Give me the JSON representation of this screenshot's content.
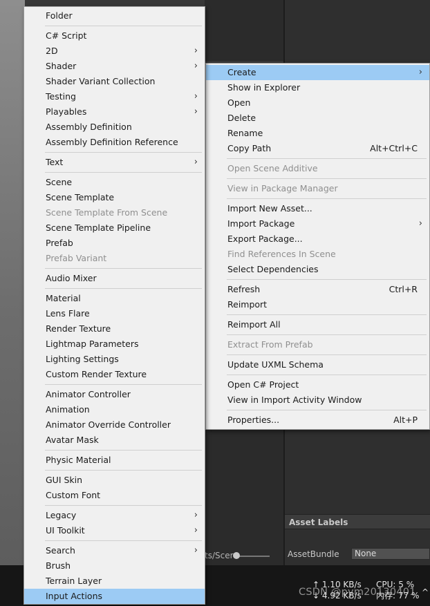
{
  "create_menu": {
    "items": [
      {
        "label": "Folder",
        "submenu": false,
        "disabled": false
      },
      {
        "label": "C# Script",
        "submenu": false,
        "disabled": false
      },
      {
        "label": "2D",
        "submenu": true,
        "disabled": false
      },
      {
        "label": "Shader",
        "submenu": true,
        "disabled": false
      },
      {
        "label": "Shader Variant Collection",
        "submenu": false,
        "disabled": false
      },
      {
        "label": "Testing",
        "submenu": true,
        "disabled": false
      },
      {
        "label": "Playables",
        "submenu": true,
        "disabled": false
      },
      {
        "label": "Assembly Definition",
        "submenu": false,
        "disabled": false
      },
      {
        "label": "Assembly Definition Reference",
        "submenu": false,
        "disabled": false
      },
      {
        "label": "Text",
        "submenu": true,
        "disabled": false
      },
      {
        "label": "Scene",
        "submenu": false,
        "disabled": false
      },
      {
        "label": "Scene Template",
        "submenu": false,
        "disabled": false
      },
      {
        "label": "Scene Template From Scene",
        "submenu": false,
        "disabled": true
      },
      {
        "label": "Scene Template Pipeline",
        "submenu": false,
        "disabled": false
      },
      {
        "label": "Prefab",
        "submenu": false,
        "disabled": false
      },
      {
        "label": "Prefab Variant",
        "submenu": false,
        "disabled": true
      },
      {
        "label": "Audio Mixer",
        "submenu": false,
        "disabled": false
      },
      {
        "label": "Material",
        "submenu": false,
        "disabled": false
      },
      {
        "label": "Lens Flare",
        "submenu": false,
        "disabled": false
      },
      {
        "label": "Render Texture",
        "submenu": false,
        "disabled": false
      },
      {
        "label": "Lightmap Parameters",
        "submenu": false,
        "disabled": false
      },
      {
        "label": "Lighting Settings",
        "submenu": false,
        "disabled": false
      },
      {
        "label": "Custom Render Texture",
        "submenu": false,
        "disabled": false
      },
      {
        "label": "Animator Controller",
        "submenu": false,
        "disabled": false
      },
      {
        "label": "Animation",
        "submenu": false,
        "disabled": false
      },
      {
        "label": "Animator Override Controller",
        "submenu": false,
        "disabled": false
      },
      {
        "label": "Avatar Mask",
        "submenu": false,
        "disabled": false
      },
      {
        "label": "Physic Material",
        "submenu": false,
        "disabled": false
      },
      {
        "label": "GUI Skin",
        "submenu": false,
        "disabled": false
      },
      {
        "label": "Custom Font",
        "submenu": false,
        "disabled": false
      },
      {
        "label": "Legacy",
        "submenu": true,
        "disabled": false
      },
      {
        "label": "UI Toolkit",
        "submenu": true,
        "disabled": false
      },
      {
        "label": "Search",
        "submenu": true,
        "disabled": false
      },
      {
        "label": "Brush",
        "submenu": false,
        "disabled": false
      },
      {
        "label": "Terrain Layer",
        "submenu": false,
        "disabled": false
      },
      {
        "label": "Input Actions",
        "submenu": false,
        "disabled": false,
        "highlighted": true
      }
    ]
  },
  "assets_menu": {
    "items": [
      {
        "label": "Create",
        "submenu": true,
        "disabled": false,
        "highlighted": true,
        "shortcut": ""
      },
      {
        "label": "Show in Explorer",
        "submenu": false,
        "disabled": false,
        "shortcut": ""
      },
      {
        "label": "Open",
        "submenu": false,
        "disabled": false,
        "shortcut": ""
      },
      {
        "label": "Delete",
        "submenu": false,
        "disabled": false,
        "shortcut": ""
      },
      {
        "label": "Rename",
        "submenu": false,
        "disabled": false,
        "shortcut": ""
      },
      {
        "label": "Copy Path",
        "submenu": false,
        "disabled": false,
        "shortcut": "Alt+Ctrl+C"
      },
      {
        "label": "Open Scene Additive",
        "submenu": false,
        "disabled": true,
        "shortcut": ""
      },
      {
        "label": "View in Package Manager",
        "submenu": false,
        "disabled": true,
        "shortcut": ""
      },
      {
        "label": "Import New Asset...",
        "submenu": false,
        "disabled": false,
        "shortcut": ""
      },
      {
        "label": "Import Package",
        "submenu": true,
        "disabled": false,
        "shortcut": ""
      },
      {
        "label": "Export Package...",
        "submenu": false,
        "disabled": false,
        "shortcut": ""
      },
      {
        "label": "Find References In Scene",
        "submenu": false,
        "disabled": true,
        "shortcut": ""
      },
      {
        "label": "Select Dependencies",
        "submenu": false,
        "disabled": false,
        "shortcut": ""
      },
      {
        "label": "Refresh",
        "submenu": false,
        "disabled": false,
        "shortcut": "Ctrl+R"
      },
      {
        "label": "Reimport",
        "submenu": false,
        "disabled": false,
        "shortcut": ""
      },
      {
        "label": "Reimport All",
        "submenu": false,
        "disabled": false,
        "shortcut": ""
      },
      {
        "label": "Extract From Prefab",
        "submenu": false,
        "disabled": true,
        "shortcut": ""
      },
      {
        "label": "Update UXML Schema",
        "submenu": false,
        "disabled": false,
        "shortcut": ""
      },
      {
        "label": "Open C# Project",
        "submenu": false,
        "disabled": false,
        "shortcut": ""
      },
      {
        "label": "View in Import Activity Window",
        "submenu": false,
        "disabled": false,
        "shortcut": ""
      },
      {
        "label": "Properties...",
        "submenu": false,
        "disabled": false,
        "shortcut": "Alt+P"
      }
    ]
  },
  "inspector": {
    "asset_labels_title": "Asset Labels",
    "assetbundle_label": "AssetBundle",
    "assetbundle_value": "None"
  },
  "project_bar": {
    "path_fragment": "ts/Scer"
  },
  "status_bar": {
    "upload_speed": "↑ 1.10 KB/s",
    "download_speed": "↓ 4.92 KB/s",
    "cpu": "CPU: 5 %",
    "memory": "内存: 77 %",
    "expand_symbol": "^"
  },
  "watermark": "CSDN @pym20130401",
  "colors": {
    "menu_bg": "#f0f0f0",
    "highlight": "#9ccbf4",
    "disabled_text": "#8f8f8f",
    "editor_dark": "#2f2f2f"
  }
}
